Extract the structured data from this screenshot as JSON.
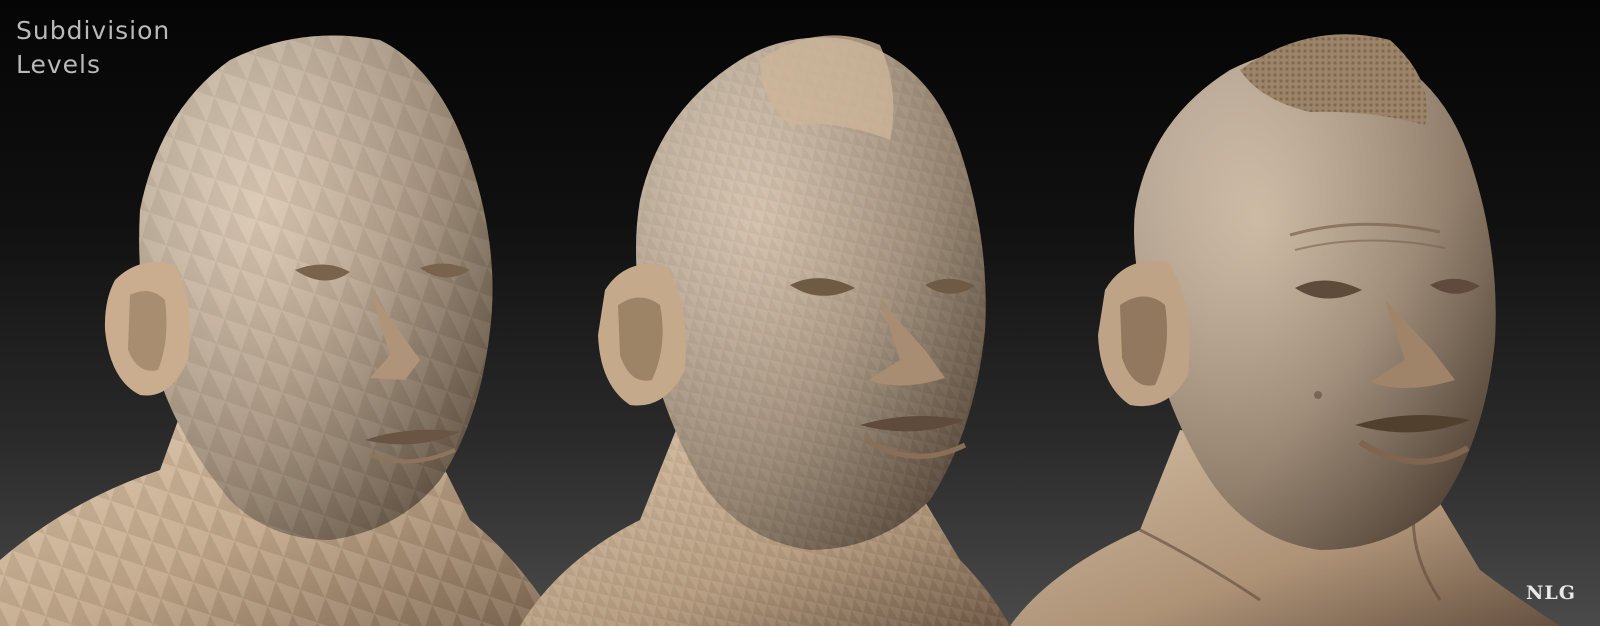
{
  "title": {
    "line1": "Subdivision",
    "line2": "Levels"
  },
  "logo": "NLG",
  "colors": {
    "clay_light": "#d8c3a8",
    "clay_mid": "#b59c80",
    "clay_dark": "#6e5a46",
    "background_top": "#050505",
    "background_bottom": "#4a4a4a"
  },
  "subjects": [
    {
      "name": "low-poly head",
      "detail": "faceted"
    },
    {
      "name": "mid subdivision head",
      "detail": "smoothed"
    },
    {
      "name": "high detail head",
      "detail": "sculpted"
    }
  ]
}
